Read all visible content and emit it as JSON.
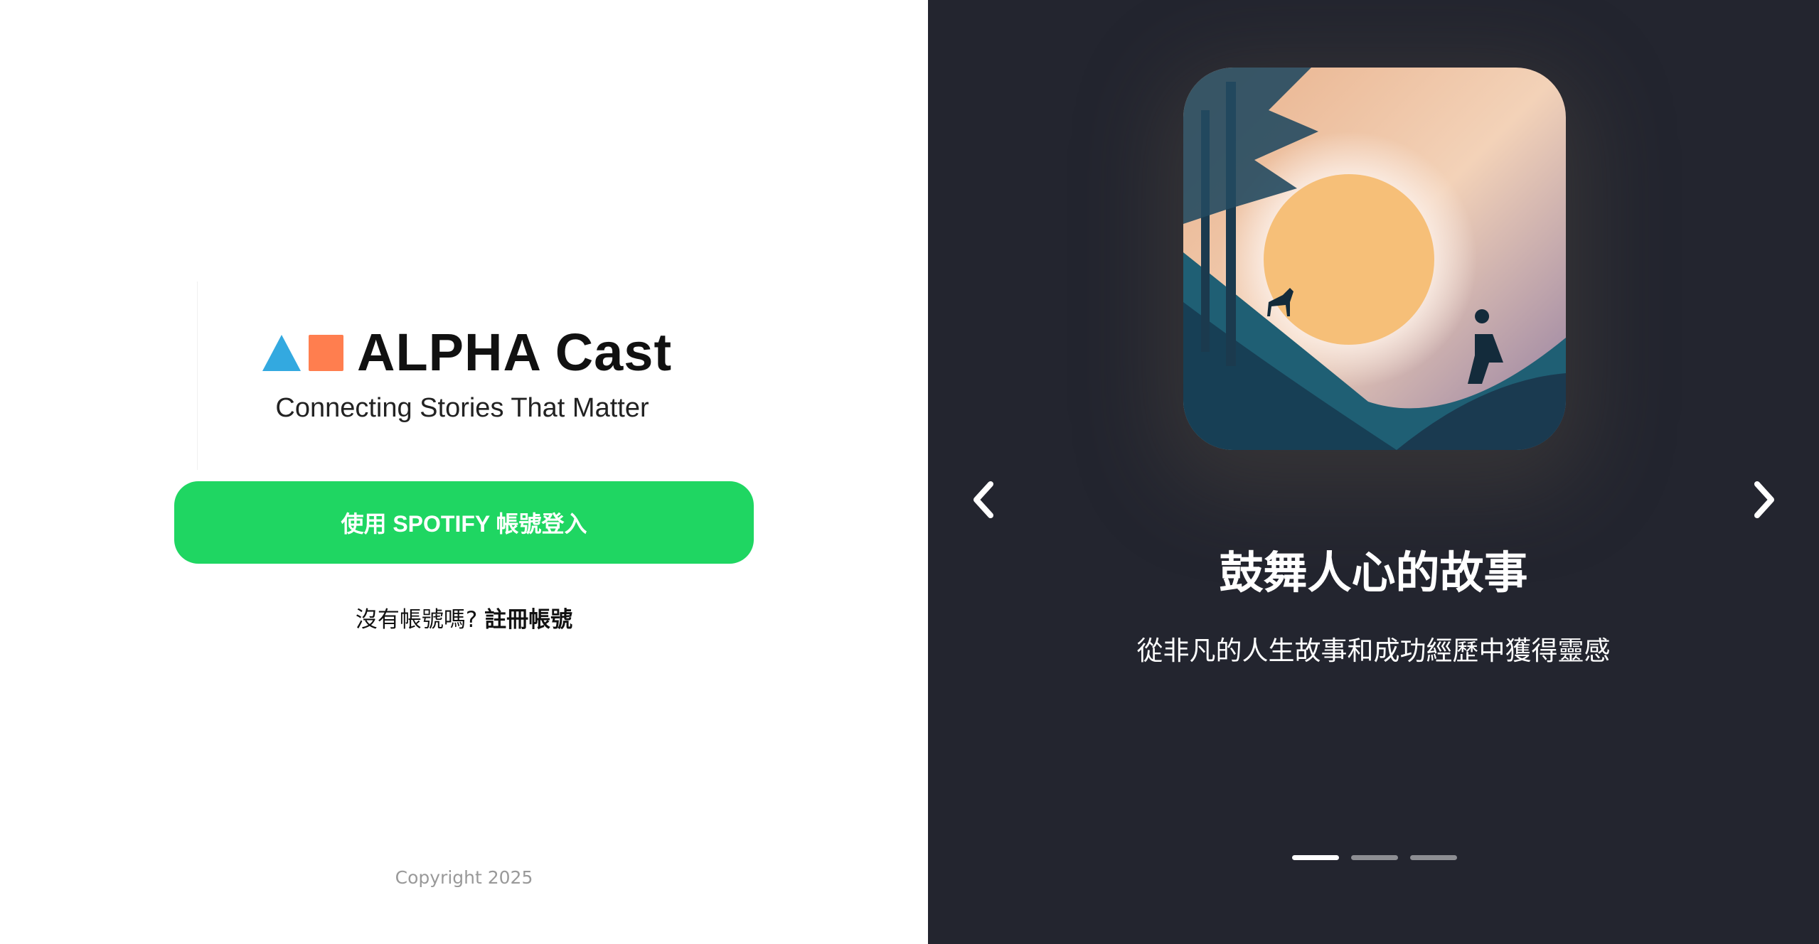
{
  "brand": {
    "name": "ALPHA Cast",
    "tagline": "Connecting Stories That Matter"
  },
  "login": {
    "spotify_button": "使用 SPOTIFY 帳號登入",
    "no_account": "沒有帳號嗎?",
    "register_link": "註冊帳號"
  },
  "footer": {
    "copyright": "Copyright 2025"
  },
  "carousel": {
    "title": "鼓舞人心的故事",
    "subtitle": "從非凡的人生故事和成功經歷中獲得靈感",
    "slide_count": 3,
    "active_index": 0
  },
  "colors": {
    "accent": "#1fd662",
    "logo_triangle": "#33a9e0",
    "logo_square": "#ff7e4f",
    "panel_bg": "#23252f"
  }
}
